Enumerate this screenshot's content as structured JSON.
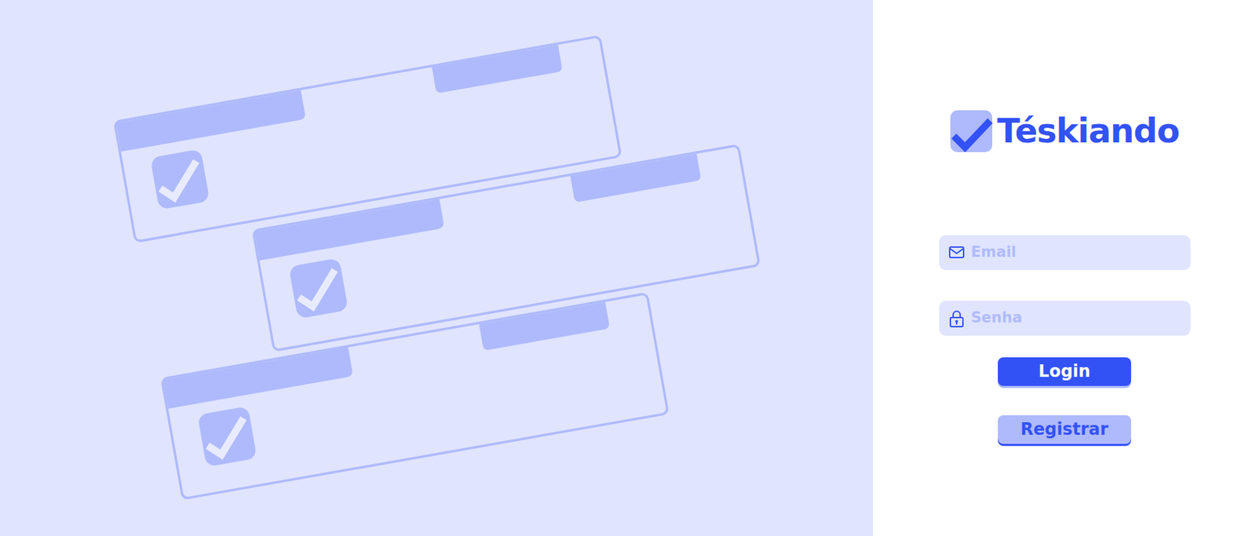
{
  "brand": {
    "name": "Téskiando"
  },
  "form": {
    "email": {
      "placeholder": "Email"
    },
    "password": {
      "placeholder": "Senha"
    },
    "buttons": [
      {
        "label": "Login",
        "kind": "primary"
      },
      {
        "label": "Registrar",
        "kind": "secondary"
      }
    ]
  },
  "illustration": {
    "cards": [
      {
        "checked": true
      },
      {
        "checked": true
      },
      {
        "checked": true
      }
    ]
  }
}
